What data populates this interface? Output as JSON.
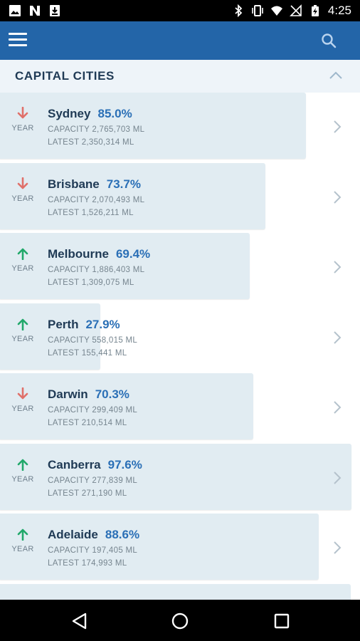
{
  "status_bar": {
    "time": "4:25",
    "left_icons": [
      "image-icon",
      "n-app-icon",
      "download-icon"
    ],
    "right_icons": [
      "bluetooth-icon",
      "vibrate-icon",
      "wifi-icon",
      "no-sim-icon",
      "battery-charging-icon"
    ]
  },
  "app_bar": {
    "menu_icon": "hamburger-menu-icon",
    "search_icon": "search-icon",
    "color": "#2365a8"
  },
  "section": {
    "title": "CAPITAL CITIES",
    "collapse_icon": "chevron-up-icon"
  },
  "colors": {
    "down": "#e0706a",
    "up": "#21a86a",
    "bar": "#e1ecf2",
    "percent": "#2a6fb6"
  },
  "cities": [
    {
      "name": "Sydney",
      "percent": "85.0%",
      "fill": 0.85,
      "trend": "down",
      "trend_label": "YEAR",
      "capacity": "CAPACITY 2,765,703 ML",
      "latest": "LATEST 2,350,314 ML"
    },
    {
      "name": "Brisbane",
      "percent": "73.7%",
      "fill": 0.737,
      "trend": "down",
      "trend_label": "YEAR",
      "capacity": "CAPACITY 2,070,493 ML",
      "latest": "LATEST 1,526,211 ML"
    },
    {
      "name": "Melbourne",
      "percent": "69.4%",
      "fill": 0.694,
      "trend": "up",
      "trend_label": "YEAR",
      "capacity": "CAPACITY 1,886,403 ML",
      "latest": "LATEST 1,309,075 ML"
    },
    {
      "name": "Perth",
      "percent": "27.9%",
      "fill": 0.279,
      "trend": "up",
      "trend_label": "YEAR",
      "capacity": "CAPACITY 558,015 ML",
      "latest": "LATEST 155,441 ML"
    },
    {
      "name": "Darwin",
      "percent": "70.3%",
      "fill": 0.703,
      "trend": "down",
      "trend_label": "YEAR",
      "capacity": "CAPACITY 299,409 ML",
      "latest": "LATEST 210,514 ML"
    },
    {
      "name": "Canberra",
      "percent": "97.6%",
      "fill": 0.976,
      "trend": "up",
      "trend_label": "YEAR",
      "capacity": "CAPACITY 277,839 ML",
      "latest": "LATEST 271,190 ML"
    },
    {
      "name": "Adelaide",
      "percent": "88.6%",
      "fill": 0.886,
      "trend": "up",
      "trend_label": "YEAR",
      "capacity": "CAPACITY 197,405 ML",
      "latest": "LATEST 174,993 ML"
    }
  ],
  "nav_bar": {
    "buttons": [
      "back-icon",
      "home-icon",
      "recents-icon"
    ]
  }
}
